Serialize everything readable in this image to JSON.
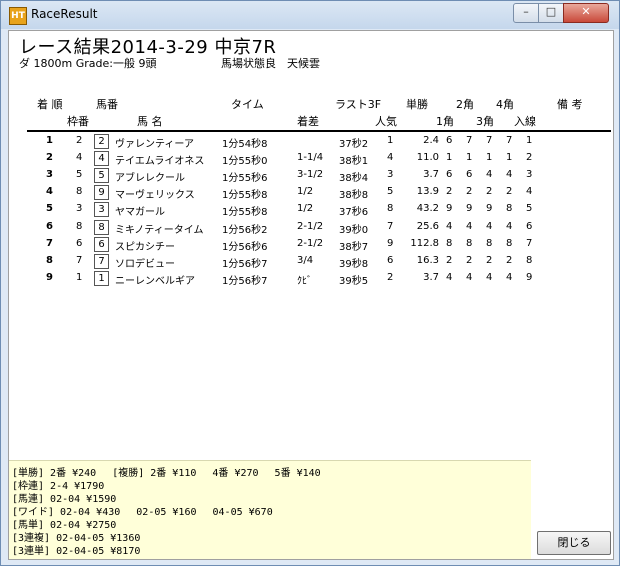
{
  "window": {
    "title": "RaceResult",
    "icon": "app-logo-icon"
  },
  "caption_buttons": {
    "minimize": "–",
    "maximize": "□",
    "close": "✕"
  },
  "race": {
    "heading": "レース結果2014-3-29 中京7R",
    "course": "ダ 1800m Grade:一般 9頭",
    "condition": "馬場状態良　天候雲"
  },
  "headers_row1": [
    "着 順",
    "馬番",
    "タイム",
    "ラスト3F",
    "単勝",
    "2角",
    "4角",
    "備 考"
  ],
  "headers_row2": [
    "枠番",
    "馬 名",
    "着差",
    "人気",
    "1角",
    "3角",
    "入線"
  ],
  "results": [
    {
      "pos": "1",
      "waku": "2",
      "num": "2",
      "name": "ヴァレンティーア",
      "time": "1分54秒8",
      "margin": "",
      "l3f": "37秒2",
      "pop": "1",
      "odds": "2.4",
      "c1": "6",
      "c2": "7",
      "c3": "7",
      "c4": "7",
      "fin": "1"
    },
    {
      "pos": "2",
      "waku": "4",
      "num": "4",
      "name": "テイエムライオネス",
      "time": "1分55秒0",
      "margin": "1-1/4",
      "l3f": "38秒1",
      "pop": "4",
      "odds": "11.0",
      "c1": "1",
      "c2": "1",
      "c3": "1",
      "c4": "1",
      "fin": "2"
    },
    {
      "pos": "3",
      "waku": "5",
      "num": "5",
      "name": "アブレレクール",
      "time": "1分55秒6",
      "margin": "3-1/2",
      "l3f": "38秒4",
      "pop": "3",
      "odds": "3.7",
      "c1": "6",
      "c2": "6",
      "c3": "4",
      "c4": "4",
      "fin": "3"
    },
    {
      "pos": "4",
      "waku": "8",
      "num": "9",
      "name": "マーヴェリックス",
      "time": "1分55秒8",
      "margin": "1/2",
      "l3f": "38秒8",
      "pop": "5",
      "odds": "13.9",
      "c1": "2",
      "c2": "2",
      "c3": "2",
      "c4": "2",
      "fin": "4"
    },
    {
      "pos": "5",
      "waku": "3",
      "num": "3",
      "name": "ヤマガール",
      "time": "1分55秒8",
      "margin": "1/2",
      "l3f": "37秒6",
      "pop": "8",
      "odds": "43.2",
      "c1": "9",
      "c2": "9",
      "c3": "9",
      "c4": "8",
      "fin": "5"
    },
    {
      "pos": "6",
      "waku": "8",
      "num": "8",
      "name": "ミキノティータイム",
      "time": "1分56秒2",
      "margin": "2-1/2",
      "l3f": "39秒0",
      "pop": "7",
      "odds": "25.6",
      "c1": "4",
      "c2": "4",
      "c3": "4",
      "c4": "4",
      "fin": "6"
    },
    {
      "pos": "7",
      "waku": "6",
      "num": "6",
      "name": "スピカシチー",
      "time": "1分56秒6",
      "margin": "2-1/2",
      "l3f": "38秒7",
      "pop": "9",
      "odds": "112.8",
      "c1": "8",
      "c2": "8",
      "c3": "8",
      "c4": "8",
      "fin": "7"
    },
    {
      "pos": "8",
      "waku": "7",
      "num": "7",
      "name": "ソロデビュー",
      "time": "1分56秒7",
      "margin": "3/4",
      "l3f": "39秒8",
      "pop": "6",
      "odds": "16.3",
      "c1": "2",
      "c2": "2",
      "c3": "2",
      "c4": "2",
      "fin": "8"
    },
    {
      "pos": "9",
      "waku": "1",
      "num": "1",
      "name": "ニーレンベルギア",
      "time": "1分56秒7",
      "margin": "ｸﾋﾞ",
      "l3f": "39秒5",
      "pop": "2",
      "odds": "3.7",
      "c1": "4",
      "c2": "4",
      "c3": "4",
      "c4": "4",
      "fin": "9"
    }
  ],
  "payouts": [
    "[単勝] 2番 ¥240　 [複勝] 2番 ¥110　 4番 ¥270　 5番 ¥140",
    "[枠連] 2-4 ¥1790",
    "[馬連] 02-04 ¥1590",
    "[ワイド] 02-04 ¥430　 02-05 ¥160　 04-05 ¥670",
    "[馬単] 02-04 ¥2750",
    "[3連複] 02-04-05 ¥1360",
    "[3連単] 02-04-05 ¥8170"
  ],
  "close_button": "閉じる"
}
